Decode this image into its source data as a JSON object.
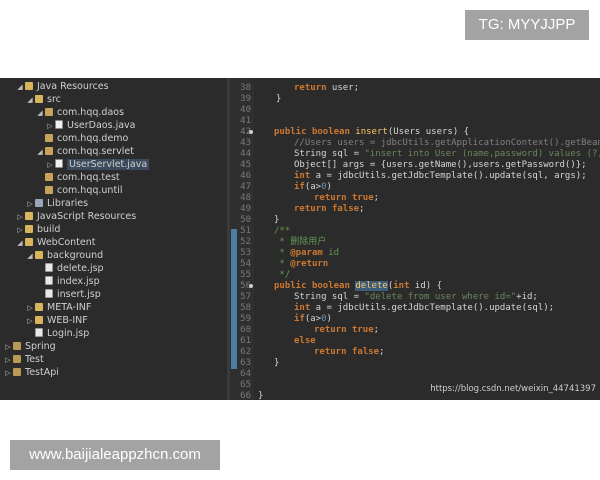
{
  "watermarks": {
    "top": "TG: MYYJJPP",
    "bottom": "www.baijialeappzhcn.com",
    "csdn": "https://blog.csdn.net/weixin_44741397"
  },
  "tree": [
    {
      "label": "Java Resources",
      "icon": "java-resources-icon"
    },
    {
      "label": "src",
      "icon": "folder-icon"
    },
    {
      "label": "com.hqq.daos",
      "icon": "package-icon"
    },
    {
      "label": "UserDaos.java",
      "icon": "java-file-icon"
    },
    {
      "label": "com.hqq.demo",
      "icon": "package-icon"
    },
    {
      "label": "com.hqq.servlet",
      "icon": "package-icon"
    },
    {
      "label": "UserServlet.java",
      "icon": "java-file-icon"
    },
    {
      "label": "com.hqq.test",
      "icon": "package-icon"
    },
    {
      "label": "com.hqq.until",
      "icon": "package-icon"
    },
    {
      "label": "Libraries",
      "icon": "library-icon"
    },
    {
      "label": "JavaScript Resources",
      "icon": "javascript-resources-icon"
    },
    {
      "label": "build",
      "icon": "folder-icon"
    },
    {
      "label": "WebContent",
      "icon": "folder-icon"
    },
    {
      "label": "background",
      "icon": "folder-icon"
    },
    {
      "label": "delete.jsp",
      "icon": "jsp-file-icon"
    },
    {
      "label": "index.jsp",
      "icon": "jsp-file-icon"
    },
    {
      "label": "insert.jsp",
      "icon": "jsp-file-icon"
    },
    {
      "label": "META-INF",
      "icon": "folder-icon"
    },
    {
      "label": "WEB-INF",
      "icon": "folder-icon"
    },
    {
      "label": "Login.jsp",
      "icon": "jsp-file-icon"
    },
    {
      "label": "Spring",
      "icon": "project-icon"
    },
    {
      "label": "Test",
      "icon": "project-icon"
    },
    {
      "label": "TestApi",
      "icon": "project-icon"
    }
  ],
  "line_numbers": [
    "38",
    "39",
    "40",
    "41",
    "42",
    "43",
    "44",
    "45",
    "46",
    "47",
    "48",
    "49",
    "50",
    "51",
    "52",
    "53",
    "54",
    "55",
    "56",
    "57",
    "58",
    "59",
    "60",
    "61",
    "62",
    "63",
    "64",
    "65",
    "66"
  ],
  "code": {
    "l38": [
      "return",
      " user;"
    ],
    "l39": "}",
    "l42": [
      "public",
      "boolean",
      "insert",
      "(Users users) {"
    ],
    "l43": "//Users users = jdbcUtils.getApplicationContext().getBean(\"use",
    "l44": [
      "String sql = ",
      "\"insert into User (name,password) values (?,?)\"",
      ";"
    ],
    "l45": [
      "Object[] args = {users.getName(),users.getPassword()};"
    ],
    "l46": [
      "int",
      " a = jdbcUtils.getJdbcTemplate().update(sql, args);"
    ],
    "l47": [
      "if",
      "(a>",
      "0",
      ")"
    ],
    "l48": [
      "return",
      "true",
      ";"
    ],
    "l49": [
      "return",
      "false",
      ";"
    ],
    "l50": "}",
    "l51": "/**",
    "l52": " * 删除用户",
    "l53": [
      " * ",
      "@param",
      " id"
    ],
    "l54": [
      " * ",
      "@return"
    ],
    "l55": " */",
    "l56": [
      "public",
      "boolean",
      "delete",
      "(",
      "int",
      " id) {"
    ],
    "l57": [
      "String sql = ",
      "\"delete from user where id=\"",
      "+id;"
    ],
    "l58": [
      "int",
      " a = jdbcUtils.getJdbcTemplate().update(sql);"
    ],
    "l59": [
      "if",
      "(a>",
      "0",
      ")"
    ],
    "l60": [
      "return",
      "true",
      ";"
    ],
    "l61": "else",
    "l62": [
      "return",
      "false",
      ";"
    ],
    "l63": "}",
    "l66": "}"
  }
}
